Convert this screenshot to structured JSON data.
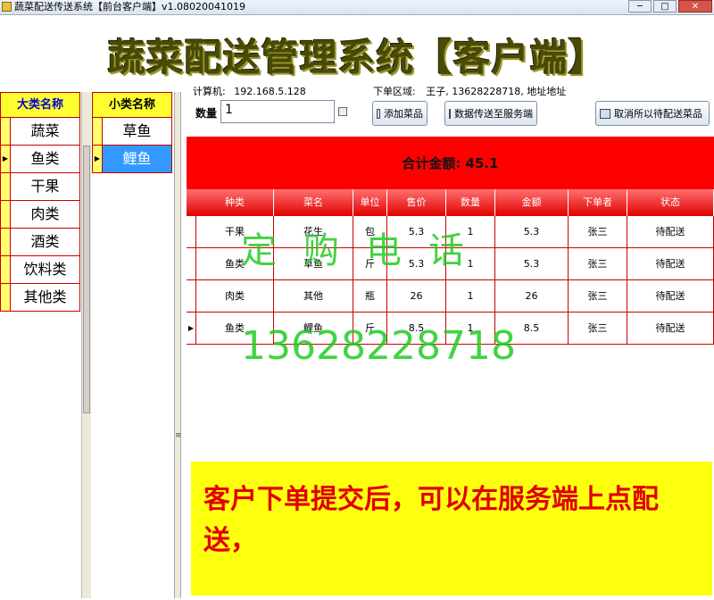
{
  "window": {
    "title": "蔬菜配送传送系统【前台客户端】v1.08020041019",
    "min": "─",
    "max": "□",
    "close": "✕"
  },
  "banner": {
    "headline": "蔬菜配送管理系统【客户端】"
  },
  "categories": {
    "header": "大类名称",
    "items": [
      {
        "label": "蔬菜",
        "indicator": ""
      },
      {
        "label": "鱼类",
        "indicator": "▶"
      },
      {
        "label": "干果",
        "indicator": ""
      },
      {
        "label": "肉类",
        "indicator": ""
      },
      {
        "label": "酒类",
        "indicator": ""
      },
      {
        "label": "饮料类",
        "indicator": ""
      },
      {
        "label": "其他类",
        "indicator": ""
      }
    ]
  },
  "subcategories": {
    "header": "小类名称",
    "items": [
      {
        "label": "草鱼",
        "indicator": ""
      },
      {
        "label": "鲤鱼",
        "indicator": "▶"
      }
    ]
  },
  "info": {
    "computer_label": "计算机:",
    "computer_value": "192.168.5.128",
    "region_label": "下单区域:",
    "region_value": "王子, 13628228718, 地址地址"
  },
  "quantity": {
    "label": "数量",
    "value": "1"
  },
  "buttons": {
    "add_dish": "添加菜品",
    "upload": "数据传送至服务端",
    "cancel_all": "取消所以待配送菜品"
  },
  "total": {
    "text": "合计金额: 45.1"
  },
  "order_table": {
    "columns": [
      "种类",
      "菜名",
      "单位",
      "售价",
      "数量",
      "金额",
      "下单者",
      "状态"
    ],
    "rows": [
      {
        "ind": "",
        "cells": [
          "干果",
          "花生",
          "包",
          "5.3",
          "1",
          "5.3",
          "张三",
          "待配送"
        ]
      },
      {
        "ind": "",
        "cells": [
          "鱼类",
          "草鱼",
          "斤",
          "5.3",
          "1",
          "5.3",
          "张三",
          "待配送"
        ]
      },
      {
        "ind": "",
        "cells": [
          "肉类",
          "其他",
          "瓶",
          "26",
          "1",
          "26",
          "张三",
          "待配送"
        ]
      },
      {
        "ind": "▶",
        "cells": [
          "鱼类",
          "鲤鱼",
          "斤",
          "8.5",
          "1",
          "8.5",
          "张三",
          "待配送"
        ]
      }
    ]
  },
  "watermark": {
    "line1": "定购电话",
    "line2": "13628228718"
  },
  "notice": {
    "text": "客户下单提交后，可以在服务端上点配送，"
  },
  "colors": {
    "header_red": "#ff0000",
    "grid_yellow": "#ffff30",
    "notice_yellow": "#ffff10",
    "notice_text": "#e00000",
    "watermark_green": "#22cc22",
    "selection_blue": "#3399ff"
  }
}
